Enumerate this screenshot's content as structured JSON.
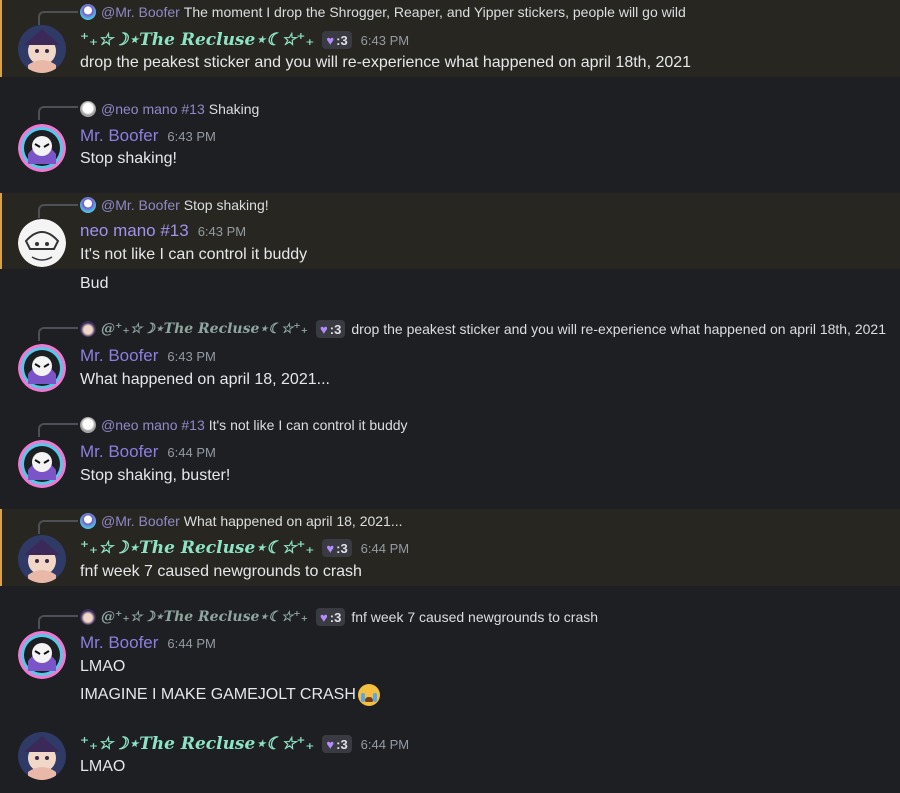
{
  "users": {
    "recluse": {
      "name": "⁺₊☆☽⋆The Recluse⋆☾☆⁺₊",
      "badge": ":3",
      "mention": "@⁺₊☆☽⋆The Recluse⋆☾☆⁺₊"
    },
    "boofer": {
      "name": "Mr. Boofer",
      "mention": "@Mr. Boofer"
    },
    "neo": {
      "name": "neo mano #13",
      "mention": "@neo mano #13"
    }
  },
  "messages": [
    {
      "reply_text": "The moment I drop the Shrogger, Reaper, and Yipper stickers, people will go wild",
      "time": "6:43 PM",
      "lines": [
        "drop the peakest sticker and you will re-experience what happened on april 18th, 2021"
      ]
    },
    {
      "reply_text": "Shaking",
      "time": "6:43 PM",
      "lines": [
        "Stop shaking!"
      ]
    },
    {
      "reply_text": "Stop shaking!",
      "time": "6:43 PM",
      "lines": [
        "It's not like I can control it buddy",
        "Bud"
      ]
    },
    {
      "reply_text": "drop the peakest sticker and you will re-experience what happened on april 18th, 2021",
      "time": "6:43 PM",
      "lines": [
        "What happened on april 18, 2021..."
      ]
    },
    {
      "reply_text": "It's not like I can control it buddy",
      "time": "6:44 PM",
      "lines": [
        "Stop shaking, buster!"
      ]
    },
    {
      "reply_text": "What happened on april 18, 2021...",
      "time": "6:44 PM",
      "lines": [
        "fnf week 7 caused newgrounds to crash"
      ]
    },
    {
      "reply_text": "fnf week 7 caused newgrounds to crash",
      "time": "6:44 PM",
      "lines": [
        "LMAO",
        "IMAGINE I MAKE GAMEJOLT CRASH"
      ]
    },
    {
      "time": "6:44 PM",
      "lines": [
        "LMAO"
      ]
    }
  ],
  "colors": {
    "background": "#1e1f22",
    "highlight": "#282620",
    "highlight_bar": "#d9a14a",
    "boofer": "#8b7fe0",
    "recluse": "#8de3c5",
    "mention": "#8f88c9"
  },
  "icons": {
    "emoji": "loudly-crying-face",
    "badge_icon": "purple-heart"
  }
}
